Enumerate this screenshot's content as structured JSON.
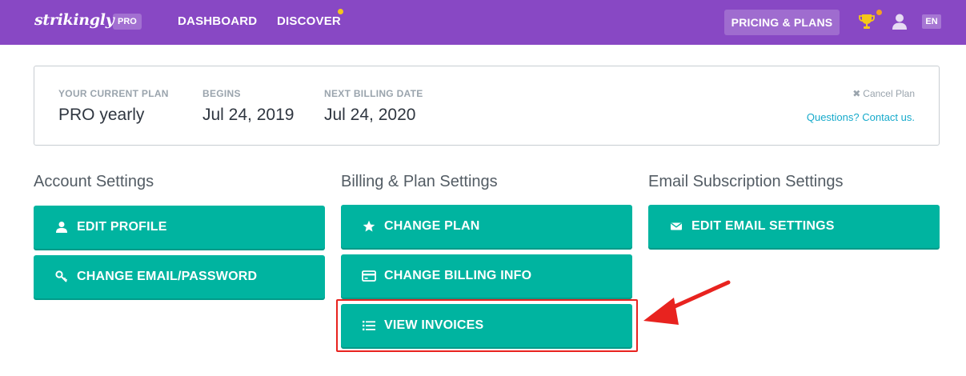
{
  "topbar": {
    "logo": "strikingly",
    "pro_badge": "PRO",
    "nav": {
      "dashboard": "DASHBOARD",
      "discover": "DISCOVER"
    },
    "pricing_button": "PRICING & PLANS",
    "language": "EN",
    "colors": {
      "bar": "#8848c4",
      "notification_dot": "#f5c71a",
      "trophy": "#f5c71a"
    }
  },
  "plan": {
    "current_plan_label": "YOUR CURRENT PLAN",
    "current_plan_value": "PRO yearly",
    "begins_label": "BEGINS",
    "begins_value": "Jul 24, 2019",
    "next_billing_label": "NEXT BILLING DATE",
    "next_billing_value": "Jul 24, 2020",
    "cancel_label": "Cancel Plan",
    "contact_label": "Questions? Contact us."
  },
  "sections": {
    "account": {
      "title": "Account Settings",
      "edit_profile": "EDIT PROFILE",
      "change_email_password": "CHANGE EMAIL/PASSWORD"
    },
    "billing": {
      "title": "Billing & Plan Settings",
      "change_plan": "CHANGE PLAN",
      "change_billing_info": "CHANGE BILLING INFO",
      "view_invoices": "VIEW INVOICES"
    },
    "email": {
      "title": "Email Subscription Settings",
      "edit_email_settings": "EDIT EMAIL SETTINGS"
    }
  },
  "icons": {
    "edit_profile": "user-icon",
    "change_email_password": "key-icon",
    "change_plan": "star-icon",
    "change_billing_info": "credit-card-icon",
    "view_invoices": "list-icon",
    "edit_email_settings": "envelope-icon"
  },
  "annotation": {
    "highlight_color": "#e8231f",
    "target": "VIEW INVOICES"
  },
  "button_color": "#00b4a0"
}
